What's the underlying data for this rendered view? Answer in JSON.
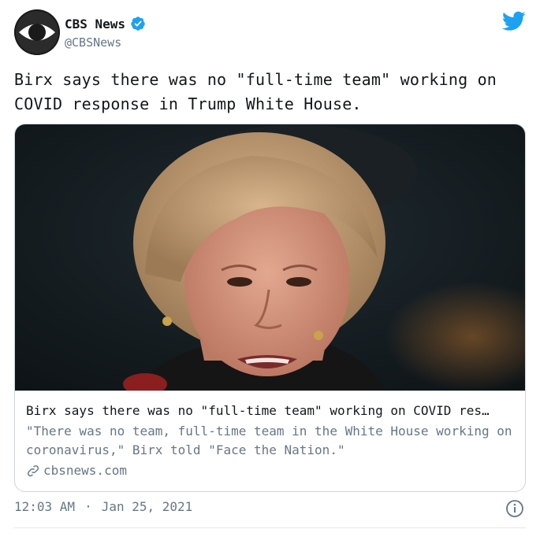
{
  "author": {
    "display_name": "CBS News",
    "handle": "@CBSNews",
    "avatar_icon": "cbs-eye-logo",
    "verified": true
  },
  "tweet": {
    "text": "Birx says there was no \"full-time team\" working on COVID response in Trump White House."
  },
  "card": {
    "title": "Birx says there was no \"full-time team\" working on COVID res…",
    "description": "\"There was no team, full-time team in the White House working on coronavirus,\" Birx told \"Face the Nation.\"",
    "domain": "cbsnews.com"
  },
  "meta": {
    "time": "12:03 AM",
    "separator": "·",
    "date": "Jan 25, 2021"
  },
  "colors": {
    "twitter_blue": "#1da1f2",
    "secondary_text": "#657786",
    "border": "#ccd6dd"
  }
}
